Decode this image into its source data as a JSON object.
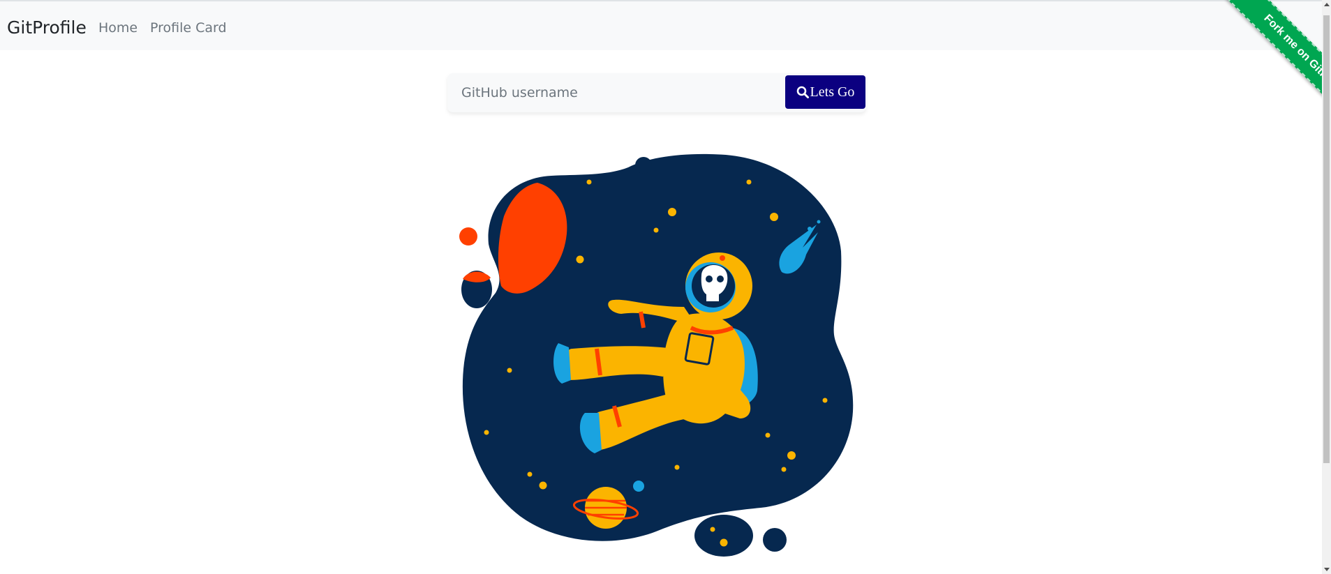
{
  "navbar": {
    "brand": "GitProfile",
    "links": [
      "Home",
      "Profile Card"
    ]
  },
  "search": {
    "placeholder": "GitHub username",
    "value": "",
    "button_label": "Lets Go"
  },
  "ribbon": {
    "label": "Fork me on GitHub"
  },
  "colors": {
    "navbar_bg": "#f8f9fa",
    "button_bg": "#0b0080",
    "ribbon_bg": "#00a651",
    "space_bg": "#06284f",
    "planet_red": "#ff4000",
    "astronaut_yellow": "#fbb400",
    "accent_blue": "#1aa3e0"
  },
  "icons": {
    "search_button": "search-icon",
    "illustration": "astronaut-illustration"
  }
}
